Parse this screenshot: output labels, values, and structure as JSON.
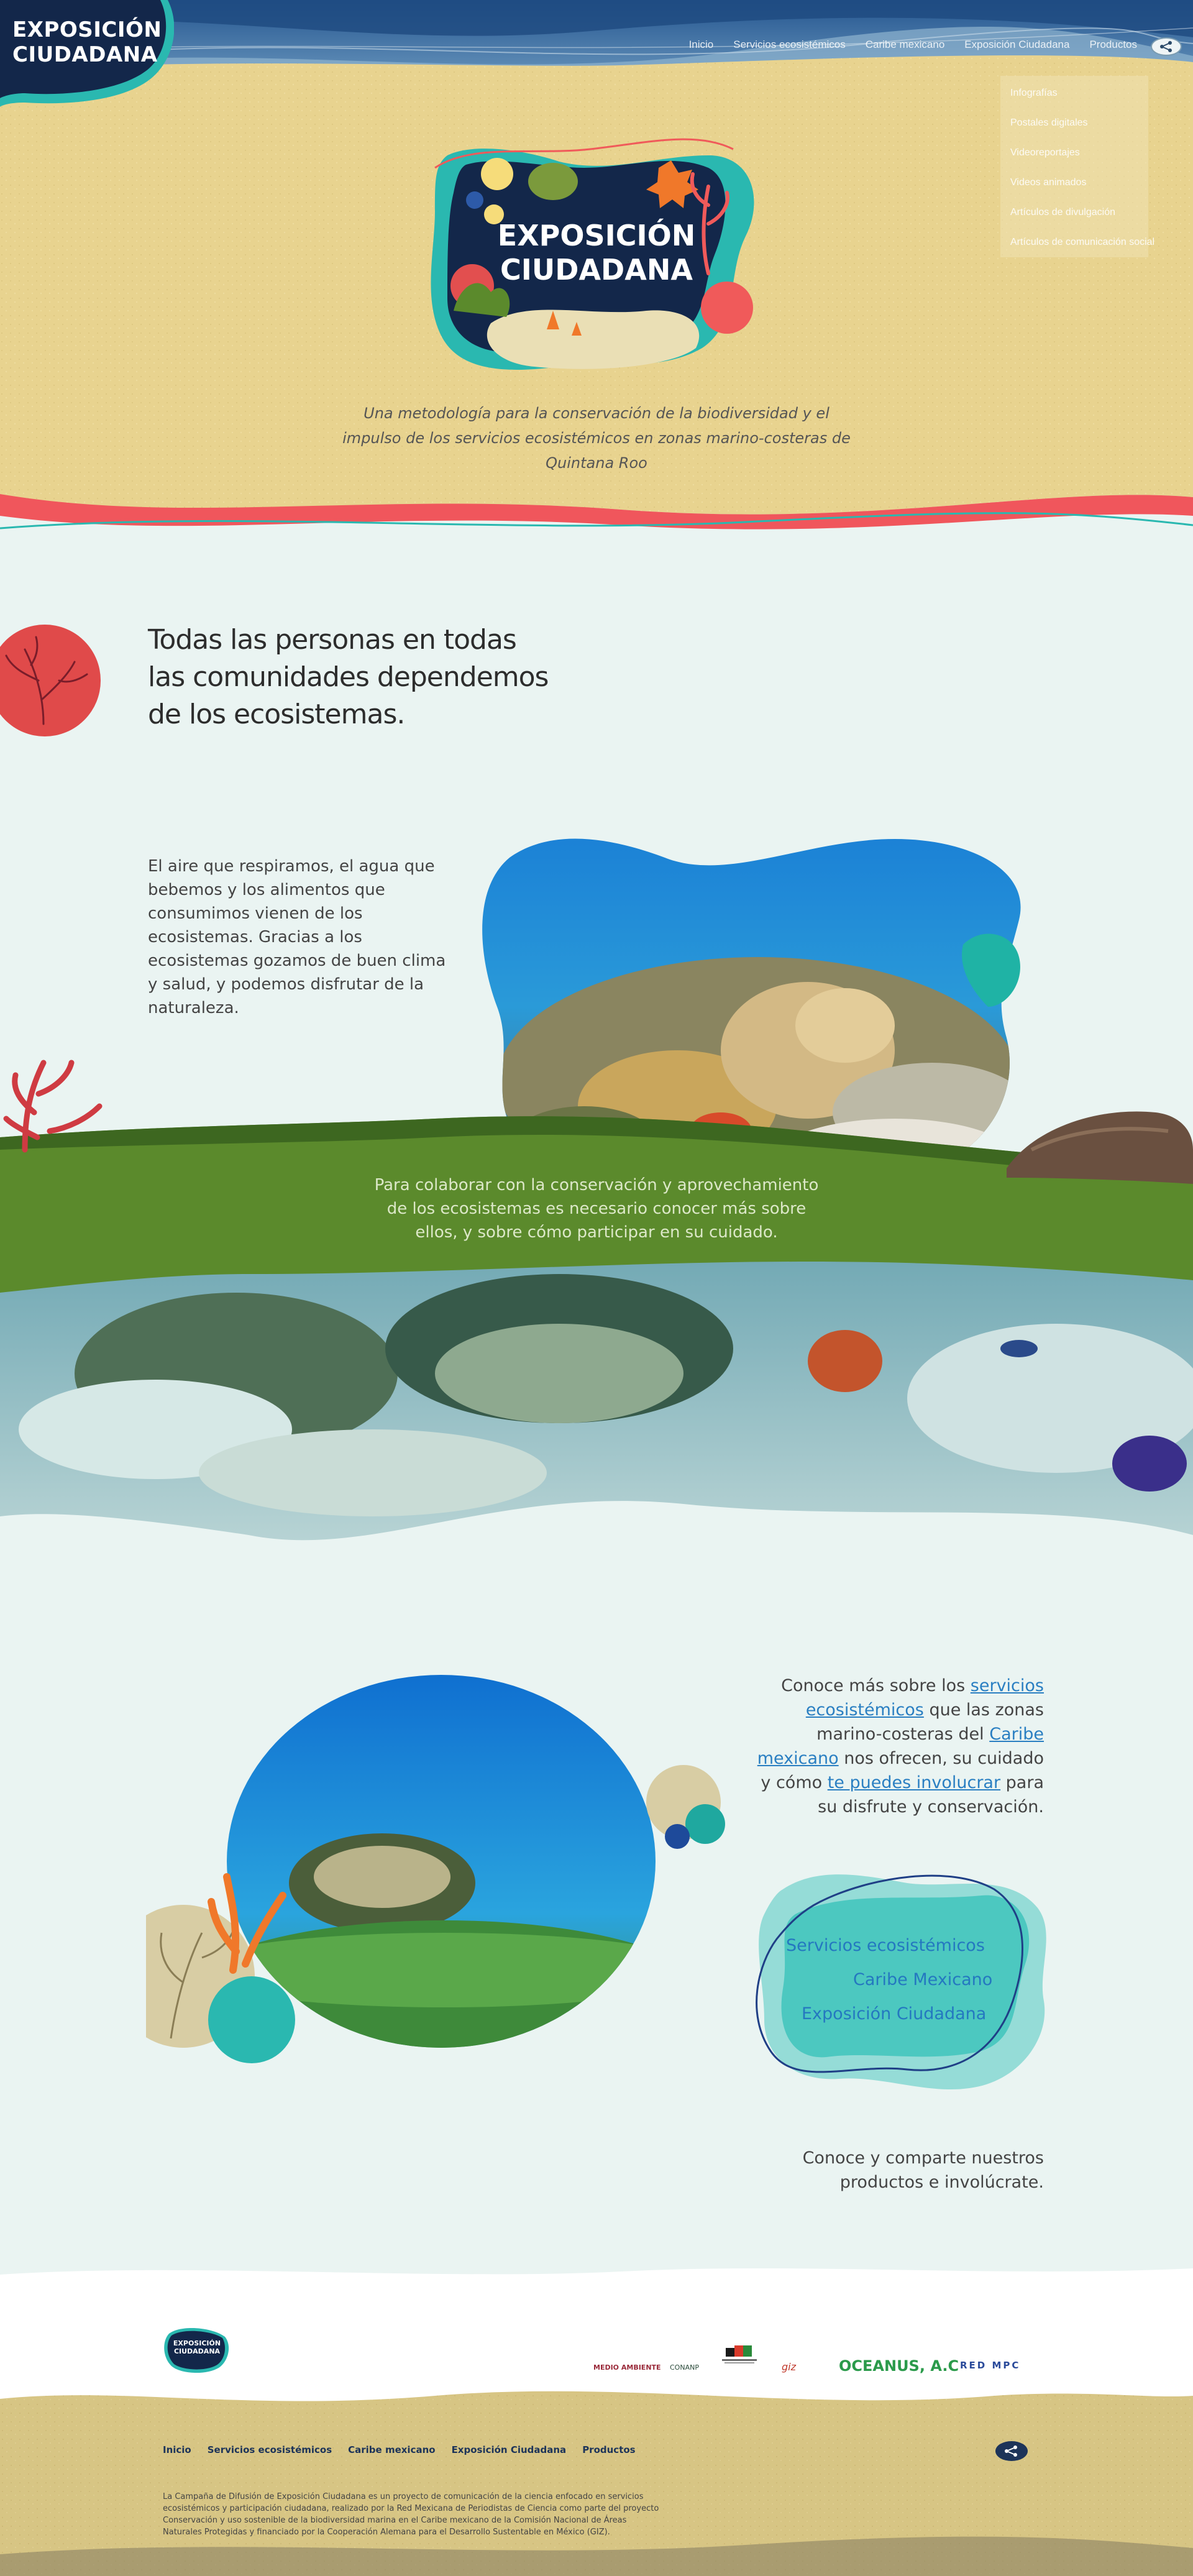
{
  "header": {
    "brand_line1": "EXPOSICIÓN",
    "brand_line2": "CIUDADANA",
    "nav": [
      "Inicio",
      "Servicios ecosistémicos",
      "Caribe mexicano",
      "Exposición Ciudadana",
      "Productos"
    ],
    "share_icon": "share-icon",
    "dropdown_items": [
      "Infografías",
      "Postales digitales",
      "Videoreportajes",
      "Videos animados",
      "Artículos de divulgación",
      "Artículos de comunicación social"
    ]
  },
  "hero": {
    "logo_line1": "EXPOSICIÓN",
    "logo_line2": "CIUDADANA",
    "tagline": "Una metodología para la conservación de la biodiversidad y el impulso de los servicios ecosistémicos en zonas marino-costeras de Quintana Roo"
  },
  "intro": {
    "heading": "Todas las personas en todas las comunidades dependemos de los ecosistemas.",
    "paragraph": "El aire que respiramos, el agua que bebemos y los alimentos que consumimos vienen de los ecosistemas. Gracias a los ecosistemas gozamos de buen clima y salud, y podemos disfrutar de la naturaleza.",
    "band_text": "Para colaborar con la conservación y aprovechamiento de los ecosistemas es necesario conocer más sobre ellos, y sobre cómo participar en su cuidado."
  },
  "learn": {
    "p1": "Conoce más sobre los ",
    "link1": "servicios ecosistémicos",
    "p2": " que las zonas marino-costeras del ",
    "link2": "Caribe mexicano",
    "p3": " nos ofrecen, su cuidado y cómo ",
    "link3": "te puedes involucrar",
    "p4": " para su disfrute y conservación.",
    "cta": [
      "Servicios ecosistémicos",
      "Caribe Mexicano",
      "Exposición Ciudadana"
    ],
    "share_prompt": "Conoce y comparte nuestros productos e involúcrate."
  },
  "footer": {
    "logo_line1": "EXPOSICIÓN",
    "logo_line2": "CIUDADANA",
    "partners": [
      "MEDIO AMBIENTE",
      "CONANP",
      "giz",
      "OCEANUS, A.C",
      "RED MPC"
    ],
    "nav": [
      "Inicio",
      "Servicios ecosistémicos",
      "Caribe mexicano",
      "Exposición Ciudadana",
      "Productos"
    ],
    "description": "La Campaña de Difusión de Exposición Ciudadana es un proyecto de comunicación de la ciencia enfocado en servicios ecosistémicos y participación ciudadana, realizado por la Red Mexicana de Periodistas de Ciencia como parte del proyecto Conservación y uso sostenible de la biodiversidad marina en el Caribe mexicano de la Comisión Nacional de Áreas Naturales Protegidas y financiado por la Cooperación Alemana para el Desarrollo Sustentable en México (GIZ)."
  },
  "colors": {
    "sand": "#e6d291",
    "navy": "#13274a",
    "teal": "#2ab8b0",
    "coral": "#f05a5a",
    "green": "#5b8a2c",
    "link": "#2478c0"
  }
}
